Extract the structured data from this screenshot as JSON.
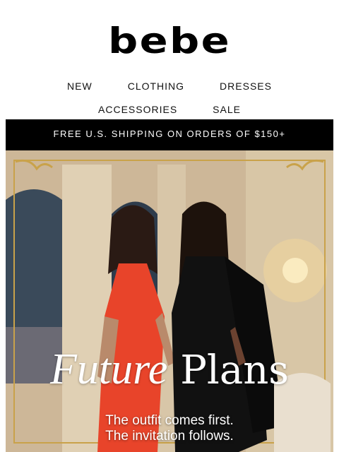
{
  "brand": {
    "logo_text": "bebe"
  },
  "nav": {
    "row1": [
      "NEW",
      "CLOTHING",
      "DRESSES"
    ],
    "row2": [
      "ACCESSORIES",
      "SALE"
    ]
  },
  "banner": {
    "text": "FREE U.S. SHIPPING ON ORDERS OF $150+"
  },
  "hero": {
    "title_italic": "Future",
    "title_regular": "Plans",
    "subtitle_line1": "The outfit comes first.",
    "subtitle_line2": "The invitation follows.",
    "colors": {
      "red_outfit": "#e8442a",
      "black_outfit": "#111111",
      "frame_gold": "#c9a24a"
    }
  }
}
